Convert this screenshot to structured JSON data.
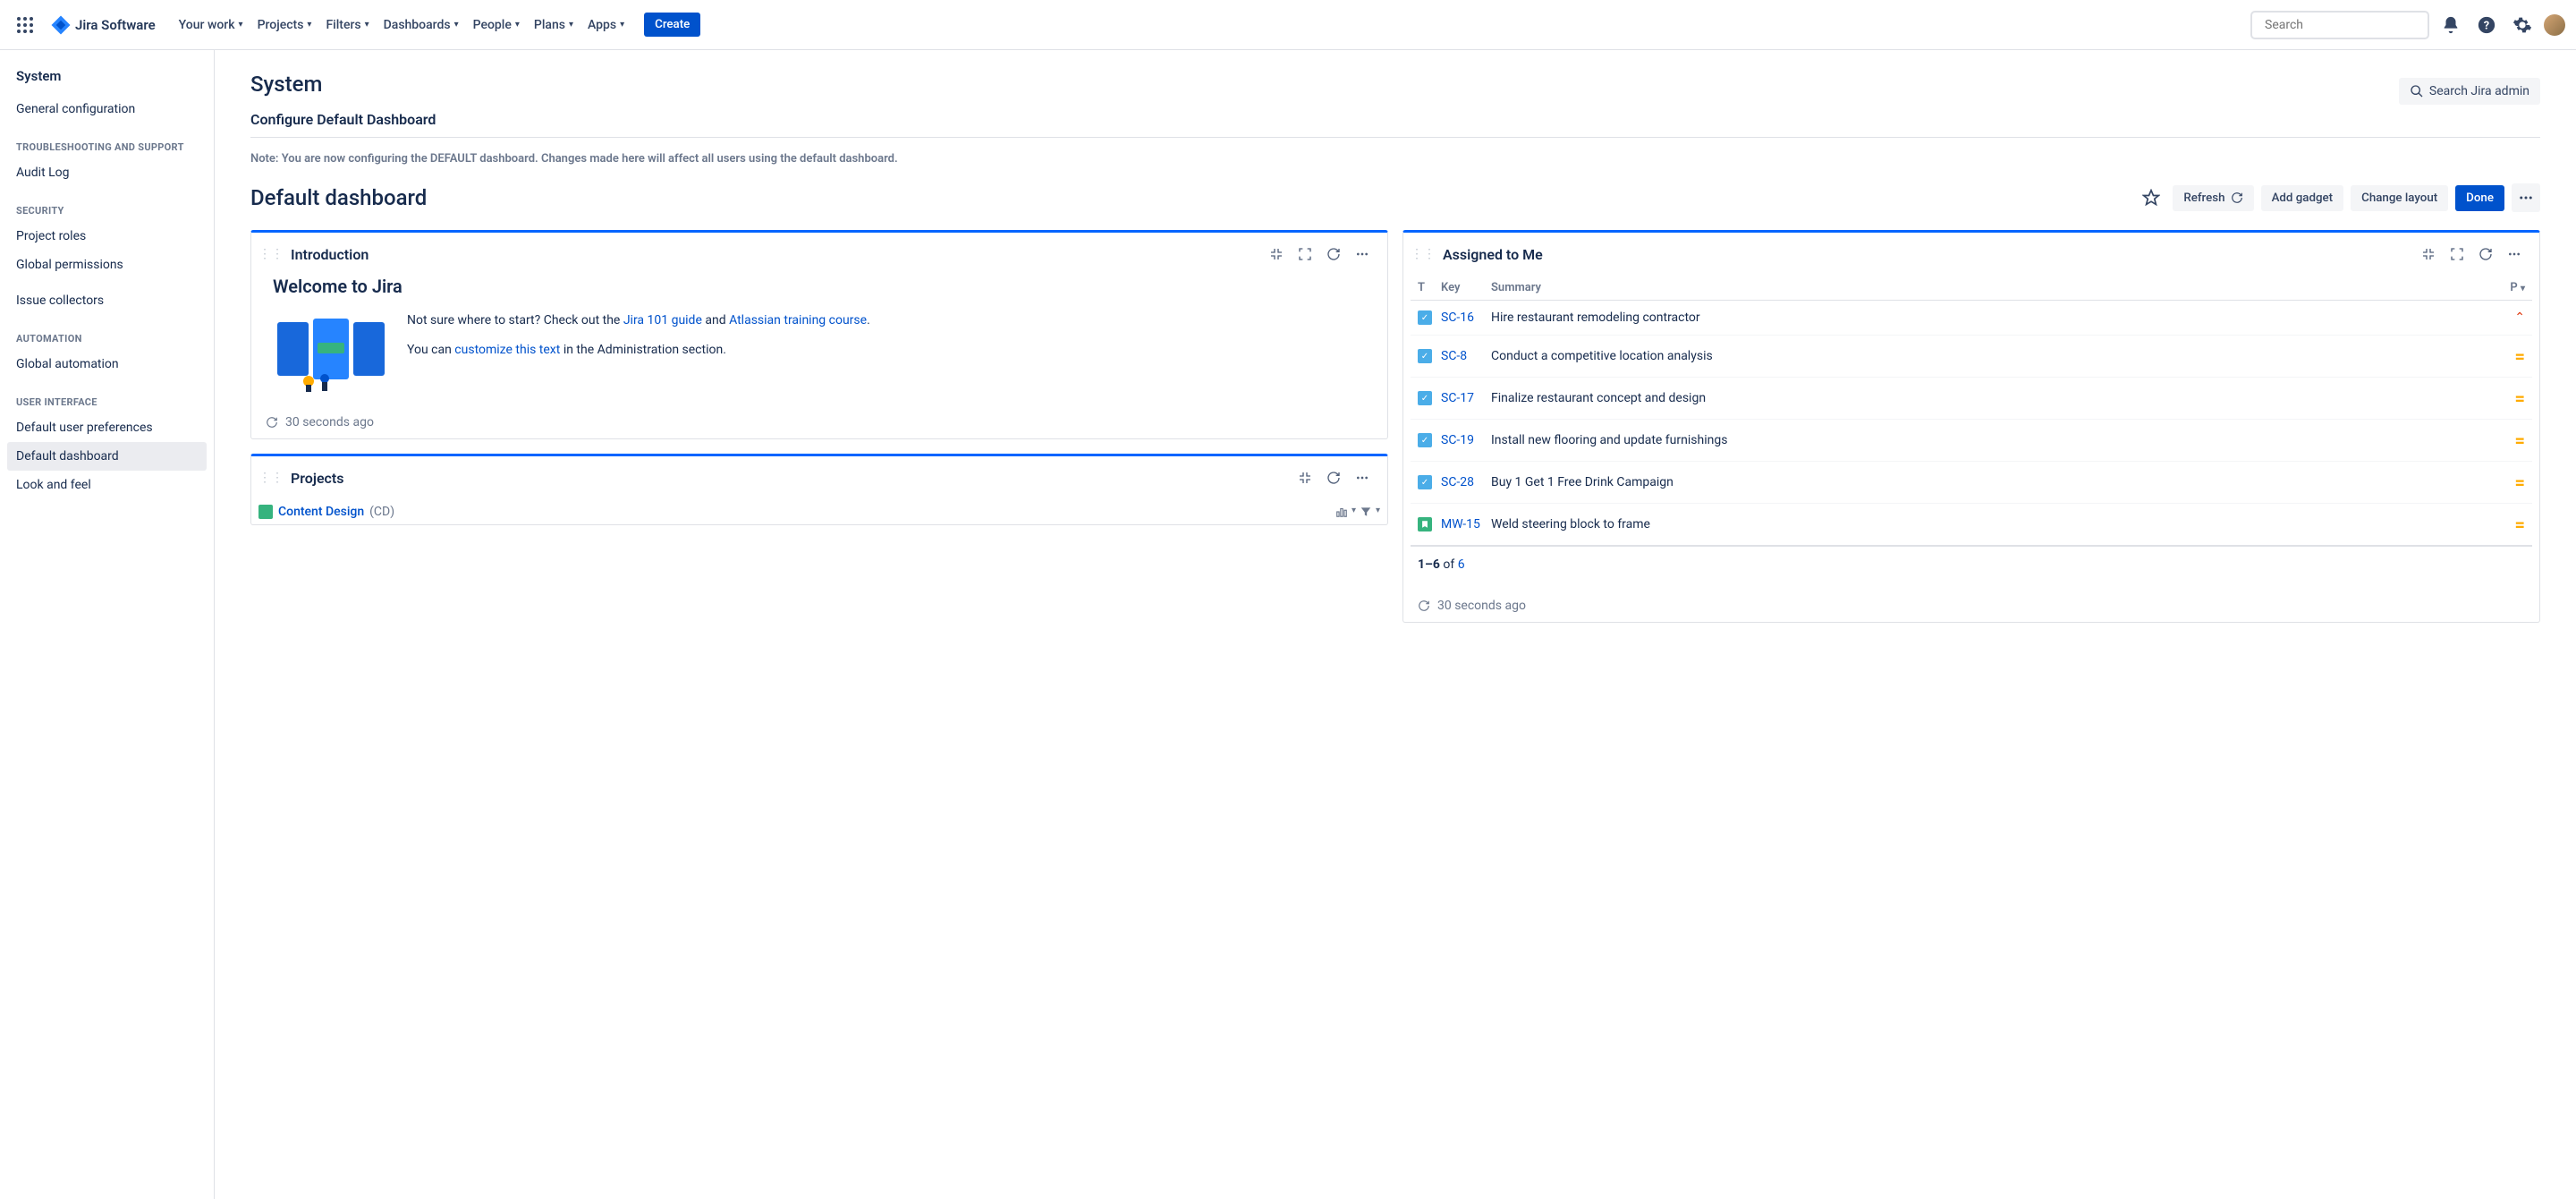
{
  "topnav": {
    "product": "Jira Software",
    "items": [
      "Your work",
      "Projects",
      "Filters",
      "Dashboards",
      "People",
      "Plans",
      "Apps"
    ],
    "create": "Create",
    "search_placeholder": "Search"
  },
  "sidebar": {
    "heading": "System",
    "groups": [
      {
        "label": null,
        "items": [
          "General configuration"
        ]
      },
      {
        "label": "TROUBLESHOOTING AND SUPPORT",
        "items": [
          "Audit Log"
        ]
      },
      {
        "label": "SECURITY",
        "items": [
          "Project roles",
          "Global permissions",
          "Issue collectors"
        ]
      },
      {
        "label": "AUTOMATION",
        "items": [
          "Global automation"
        ]
      },
      {
        "label": "USER INTERFACE",
        "items": [
          "Default user preferences",
          "Default dashboard",
          "Look and feel"
        ],
        "active": "Default dashboard"
      }
    ]
  },
  "page": {
    "title": "System",
    "admin_search": "Search Jira admin",
    "subheading": "Configure Default Dashboard",
    "note": "Note: You are now configuring the DEFAULT dashboard. Changes made here will affect all users using the default dashboard.",
    "dash_title": "Default dashboard",
    "actions": {
      "refresh": "Refresh",
      "add_gadget": "Add gadget",
      "change_layout": "Change layout",
      "done": "Done"
    }
  },
  "gadgets": {
    "introduction": {
      "title": "Introduction",
      "heading": "Welcome to Jira",
      "line1_pre": "Not sure where to start? Check out the ",
      "link1": "Jira 101 guide",
      "line1_mid": " and ",
      "link2": "Atlassian training course",
      "line1_post": ".",
      "line2_pre": "You can ",
      "link3": "customize this text",
      "line2_post": " in the Administration section.",
      "timestamp": "30 seconds ago"
    },
    "projects": {
      "title": "Projects",
      "item_name": "Content Design",
      "item_code": "(CD)"
    },
    "assigned": {
      "title": "Assigned to Me",
      "columns": {
        "t": "T",
        "key": "Key",
        "summary": "Summary",
        "p": "P"
      },
      "rows": [
        {
          "type": "task",
          "key": "SC-16",
          "summary": "Hire restaurant remodeling contractor",
          "priority": "high"
        },
        {
          "type": "task",
          "key": "SC-8",
          "summary": "Conduct a competitive location analysis",
          "priority": "medium"
        },
        {
          "type": "task",
          "key": "SC-17",
          "summary": "Finalize restaurant concept and design",
          "priority": "medium"
        },
        {
          "type": "task",
          "key": "SC-19",
          "summary": "Install new flooring and update furnishings",
          "priority": "medium"
        },
        {
          "type": "task",
          "key": "SC-28",
          "summary": "Buy 1 Get 1 Free Drink Campaign",
          "priority": "medium"
        },
        {
          "type": "story",
          "key": "MW-15",
          "summary": "Weld steering block to frame",
          "priority": "medium"
        }
      ],
      "pagination_range": "1–6",
      "pagination_of": " of ",
      "pagination_total": "6",
      "timestamp": "30 seconds ago"
    }
  }
}
